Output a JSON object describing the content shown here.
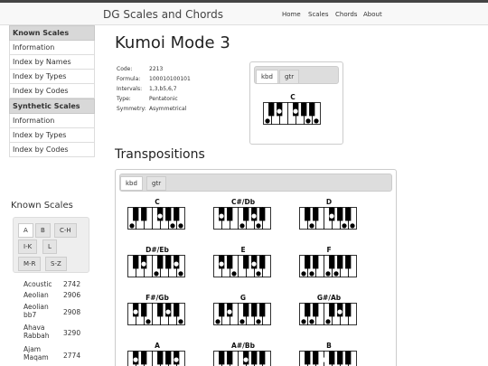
{
  "header": {
    "brand": "DG Scales and Chords",
    "nav": [
      "Home",
      "Scales",
      "Chords",
      "About"
    ]
  },
  "sidebar": {
    "known_heading": "Known Scales",
    "known_items": [
      "Information",
      "Index by Names",
      "Index by Types",
      "Index by Codes"
    ],
    "synthetic_heading": "Synthetic Scales",
    "synthetic_items": [
      "Information",
      "Index by Types",
      "Index by Codes"
    ]
  },
  "known_scales": {
    "title": "Known Scales",
    "tabs": [
      "A",
      "B",
      "C-H",
      "I-K",
      "L",
      "M-R",
      "S-Z"
    ],
    "active_tab": "A",
    "rows": [
      {
        "name": "Acoustic",
        "code": "2742"
      },
      {
        "name": "Aeolian",
        "code": "2906"
      },
      {
        "name": "Aeolian bb7",
        "code": "2908"
      },
      {
        "name": "Ahava Rabbah",
        "code": "3290"
      },
      {
        "name": "Ajam Maqam",
        "code": "2774"
      }
    ]
  },
  "scale": {
    "title": "Kumoi Mode 3",
    "info": [
      {
        "label": "Code:",
        "value": "2213"
      },
      {
        "label": "Formula:",
        "value": "100010100101"
      },
      {
        "label": "Intervals:",
        "value": "1,3,b5,6,7"
      },
      {
        "label": "Type:",
        "value": "Pentatonic"
      },
      {
        "label": "Symmetry:",
        "value": "Asymmetrical"
      }
    ],
    "root_chord": "C",
    "view_tabs": [
      "kbd",
      "gtr"
    ]
  },
  "transpositions": {
    "title": "Transpositions",
    "view_tabs": [
      "kbd",
      "gtr"
    ],
    "keys": [
      "C",
      "C#/Db",
      "D",
      "D#/Eb",
      "E",
      "F",
      "F#/Gb",
      "G",
      "G#/Ab",
      "A",
      "A#/Bb",
      "B"
    ]
  },
  "colors": {
    "topbar": "#f8f8f8",
    "sidebar_head": "#d8d8d8",
    "key_black": "#000000"
  }
}
